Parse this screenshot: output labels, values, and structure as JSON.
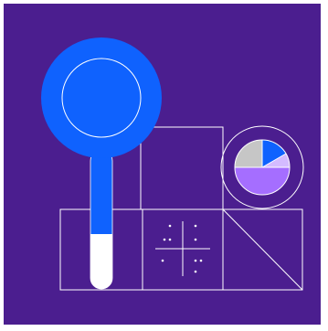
{
  "illustration": {
    "subject": "magnifying-glass-over-data-grid",
    "icons": [
      "magnifier-icon",
      "pie-chart-icon",
      "crosshair-grid-icon",
      "triangle-icon"
    ]
  },
  "colors": {
    "background": "#4b1e8f",
    "line": "#ffffff",
    "magnifier_blue": "#0f62fe",
    "pie_blue": "#0f62fe",
    "pie_gray": "#c6c6c6",
    "pie_purple": "#a56eff",
    "pie_lavender": "#d4bbff",
    "outer_frame": "#ffffff"
  }
}
